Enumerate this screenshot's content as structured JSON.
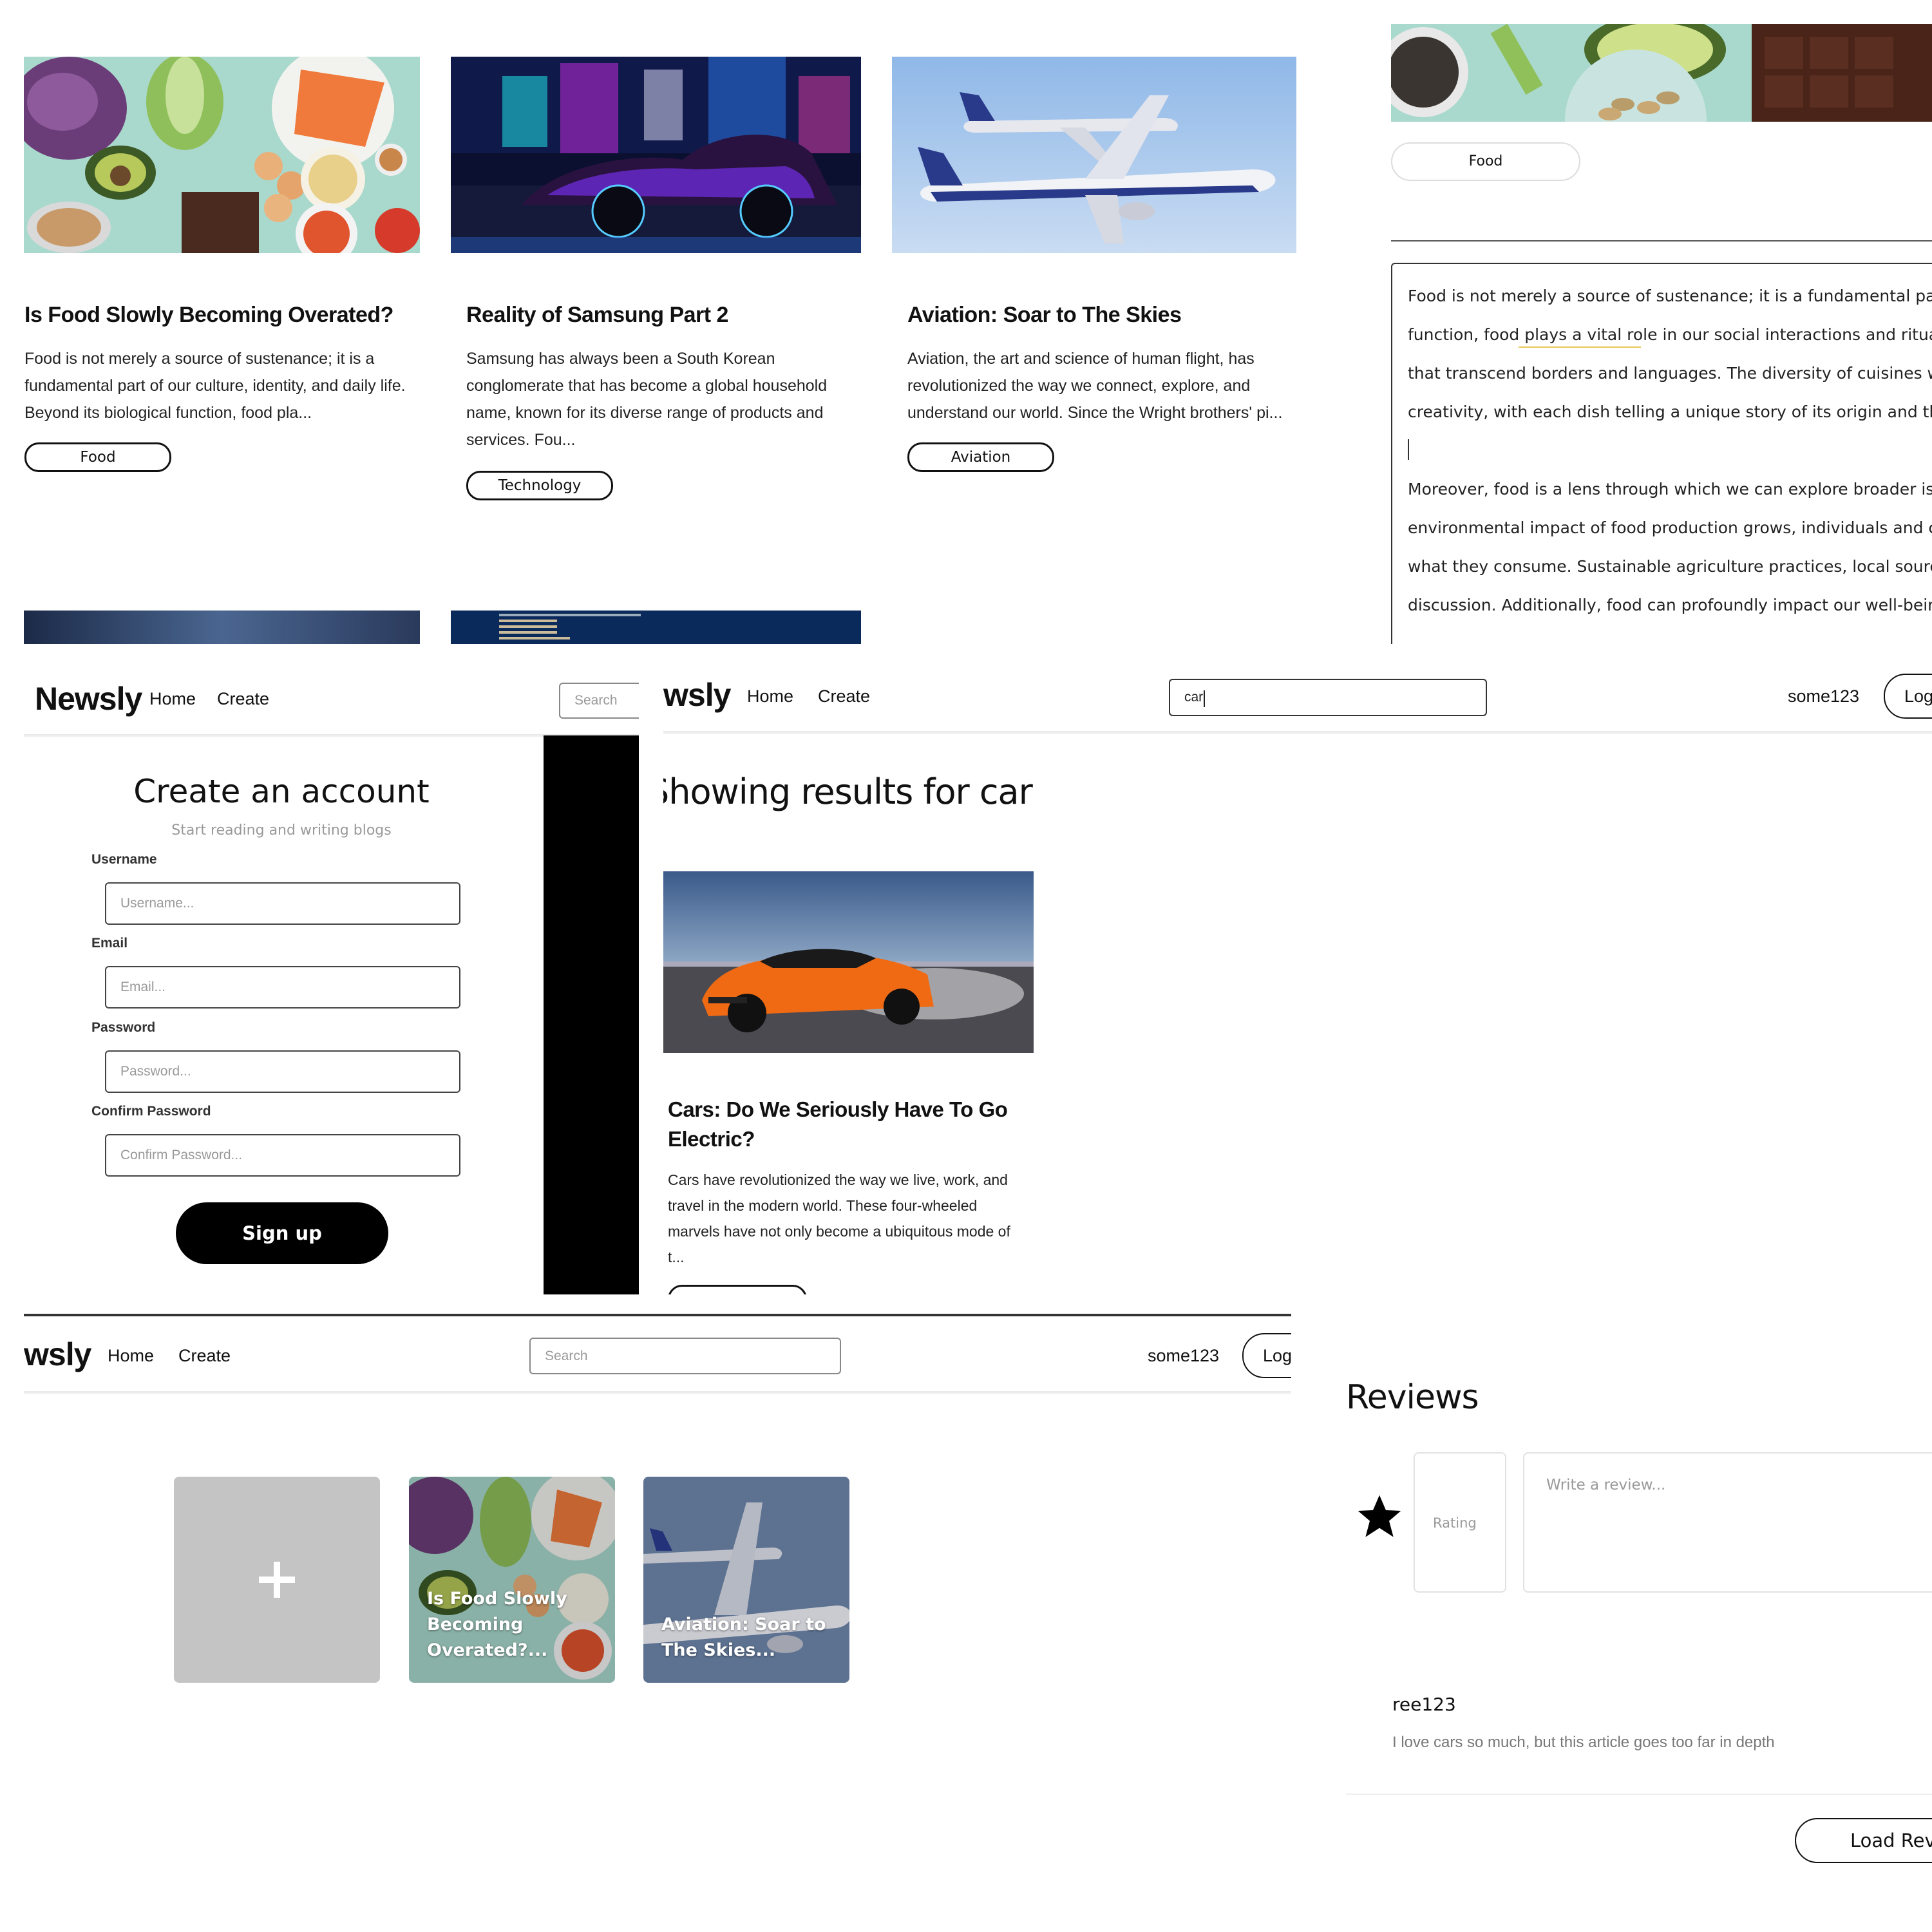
{
  "article_grid": {
    "articles": [
      {
        "title": "Is Food Slowly Becoming Overated?",
        "excerpt": [
          "Food is not merely a source of sustenance; it is a",
          "fundamental part of our culture, identity, and daily life.",
          "Beyond its biological function, food pla..."
        ],
        "tag": "Food",
        "image_icon": "food-ingredients-image"
      },
      {
        "title": "Reality of Samsung Part 2",
        "excerpt": [
          "Samsung has always been a South Korean",
          "conglomerate that has become a global household",
          "name, known for its diverse range of products and",
          "services. Fou..."
        ],
        "tag": "Technology",
        "image_icon": "neon-car-image"
      },
      {
        "title": "Aviation: Soar to The Skies",
        "excerpt": [
          "Aviation, the art and science of human flight, has",
          "revolutionized the way we connect, explore, and",
          "understand our world. Since the Wright brothers' pi..."
        ],
        "tag": "Aviation",
        "image_icon": "airplanes-image"
      }
    ]
  },
  "article_detail": {
    "tag": "Food",
    "body_lines": [
      "Food is not merely a source of sustenance; it is a fundamental part of c",
      "function, food plays a vital role in our social interactions and rituals. It l",
      "that transcend borders and languages. The diversity of cuisines world",
      "creativity, with each dish telling a unique story of its origin and the peo",
      "",
      "Moreover, food is a lens through which we can explore broader issues s",
      "environmental impact of food production grows, individuals and comm",
      "what they consume. Sustainable agriculture practices, local sourcing, c",
      "discussion. Additionally, food can profoundly impact our well-being, in"
    ]
  },
  "signup": {
    "nav": {
      "brand": "Newsly",
      "home": "Home",
      "create": "Create",
      "search_placeholder": "Search"
    },
    "title": "Create an account",
    "subtitle": "Start reading and writing blogs",
    "fields": [
      {
        "label": "Username",
        "placeholder": "Username..."
      },
      {
        "label": "Email",
        "placeholder": "Email..."
      },
      {
        "label": "Password",
        "placeholder": "Password..."
      },
      {
        "label": "Confirm Password",
        "placeholder": "Confirm Password..."
      }
    ],
    "submit": "Sign up"
  },
  "search_results": {
    "nav": {
      "brand": "wsly",
      "home": "Home",
      "create": "Create",
      "search_value": "car",
      "username": "some123",
      "logout": "Logo"
    },
    "heading": "Showing results for car",
    "result": {
      "title_lines": [
        "Cars: Do We Seriously Have To Go",
        "Electric?"
      ],
      "excerpt": [
        "Cars have revolutionized the way we live, work, and",
        "travel in the modern world. These four-wheeled",
        "marvels have not only become a ubiquitous mode of",
        "t..."
      ],
      "image_icon": "orange-sports-car-image"
    }
  },
  "my_articles": {
    "nav": {
      "brand": "wsly",
      "home": "Home",
      "create": "Create",
      "search_placeholder": "Search",
      "username": "some123",
      "logout": "Logo"
    },
    "add_icon": "plus-icon",
    "tiles": [
      {
        "caption": "Is Food Slowly Becoming Overated?...",
        "image_icon": "food-ingredients-image"
      },
      {
        "caption": "Aviation: Soar to The Skies...",
        "image_icon": "airplanes-image"
      }
    ]
  },
  "reviews": {
    "heading": "Reviews",
    "rating_placeholder": "Rating",
    "review_placeholder": "Write a review...",
    "star_icon": "star-icon",
    "items": [
      {
        "author": "ree123",
        "text": "I love cars so much, but this article goes too far in depth"
      }
    ],
    "load_button": "Load Rev"
  }
}
